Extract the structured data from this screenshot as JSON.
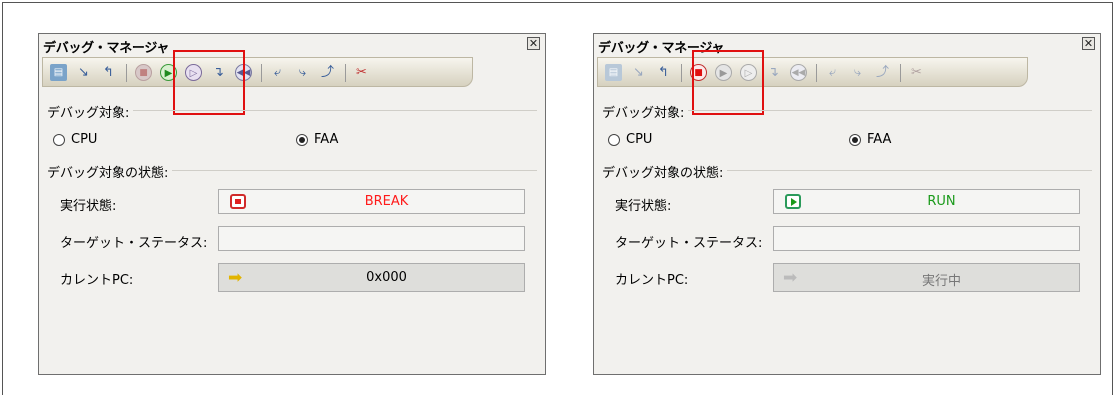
{
  "panels": [
    {
      "title": "デバッグ・マネージャ",
      "group_target": "デバッグ対象:",
      "radio_cpu": "CPU",
      "radio_faa": "FAA",
      "selected": "FAA",
      "group_status": "デバッグ対象の状態:",
      "exec_state_label": "実行状態:",
      "exec_state_value": "BREAK",
      "exec_state_color": "#ff1a1a",
      "target_status_label": "ターゲット・ステータス:",
      "target_status_value": "",
      "current_pc_label": "カレントPC:",
      "current_pc_value": "0x000",
      "highlighted_button": "run-button"
    },
    {
      "title": "デバッグ・マネージャ",
      "group_target": "デバッグ対象:",
      "radio_cpu": "CPU",
      "radio_faa": "FAA",
      "selected": "FAA",
      "group_status": "デバッグ対象の状態:",
      "exec_state_label": "実行状態:",
      "exec_state_value": "RUN",
      "exec_state_color": "#1a9a1a",
      "target_status_label": "ターゲット・ステータス:",
      "target_status_value": "",
      "current_pc_label": "カレントPC:",
      "current_pc_value": "実行中",
      "highlighted_button": "stop-button"
    }
  ],
  "icons": {
    "close": "close-icon",
    "break_state": "stop-icon",
    "run_state": "play-icon",
    "current_pc": "arrow-right-icon"
  },
  "colors": {
    "highlight": "#e01010",
    "break_text": "#ff1a1a",
    "run_text": "#1a9a1a",
    "panel_bg": "#f2f1ee"
  }
}
